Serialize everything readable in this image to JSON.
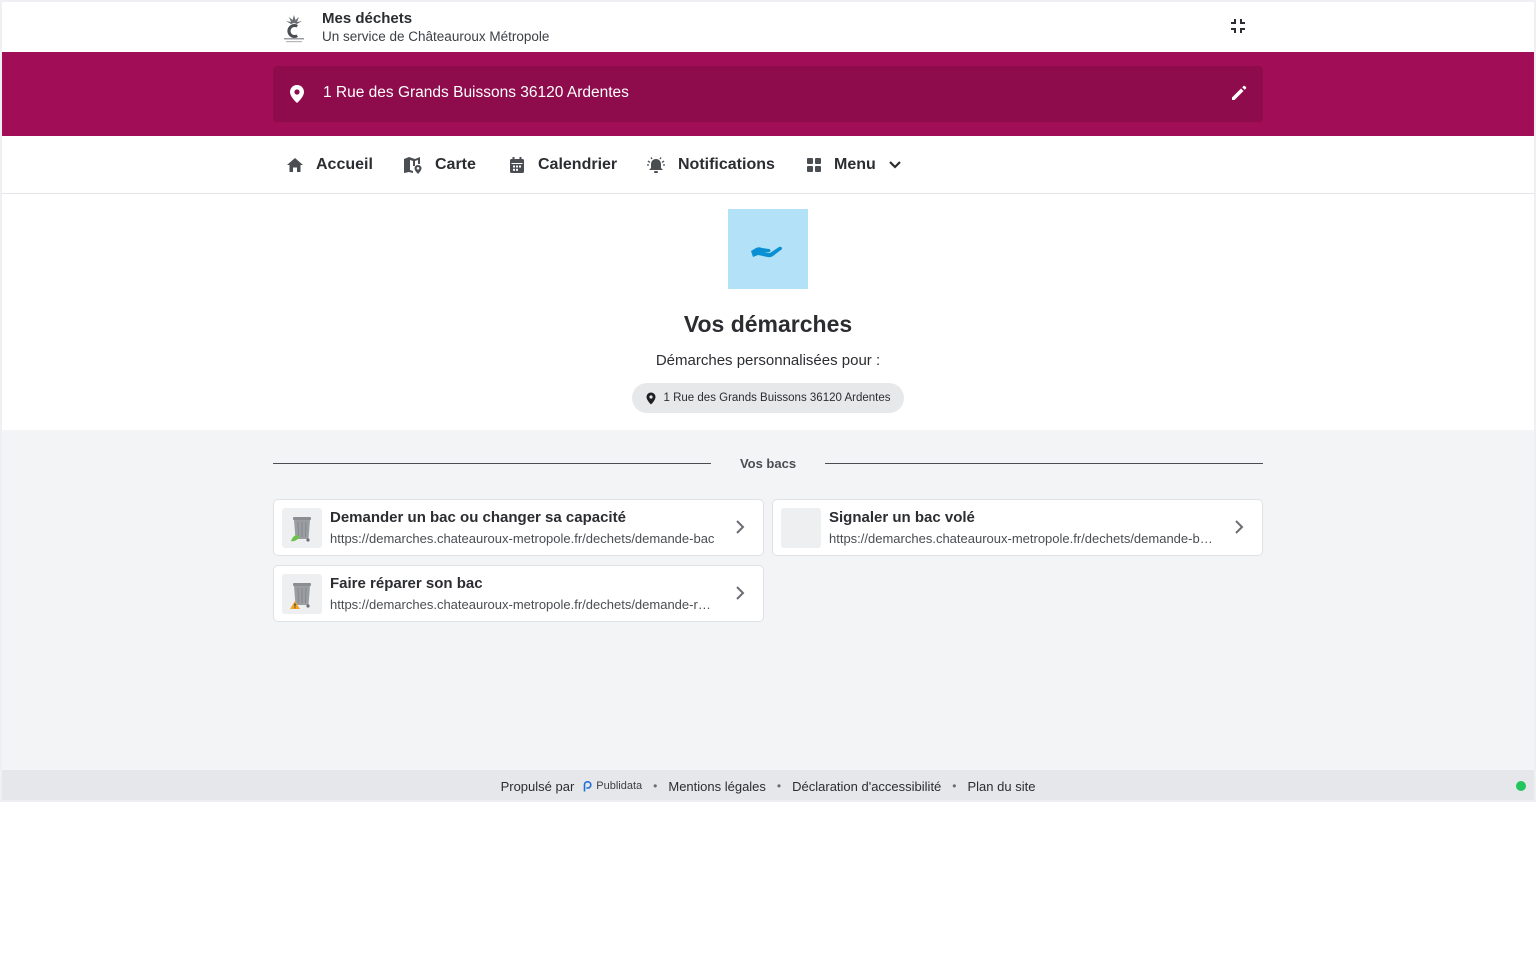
{
  "header": {
    "title": "Mes déchets",
    "subtitle": "Un service de Châteauroux Métropole"
  },
  "address": {
    "text": "1 Rue des Grands Buissons 36120 Ardentes"
  },
  "nav": {
    "items": [
      {
        "label": "Accueil",
        "icon": "home-icon"
      },
      {
        "label": "Carte",
        "icon": "map-icon"
      },
      {
        "label": "Calendrier",
        "icon": "calendar-icon"
      },
      {
        "label": "Notifications",
        "icon": "bell-icon"
      },
      {
        "label": "Menu",
        "icon": "grid-icon"
      }
    ]
  },
  "hero": {
    "title": "Vos démarches",
    "subtitle": "Démarches personnalisées pour :",
    "chip": "1 Rue des Grands Buissons 36120 Ardentes"
  },
  "section": {
    "label": "Vos bacs"
  },
  "cards": [
    {
      "title": "Demander un bac ou changer sa capacité",
      "url": "https://demarches.chateauroux-metropole.fr/dechets/demande-bac"
    },
    {
      "title": "Signaler un bac volé",
      "url": "https://demarches.chateauroux-metropole.fr/dechets/demande-bac-vole"
    },
    {
      "title": "Faire réparer son bac",
      "url": "https://demarches.chateauroux-metropole.fr/dechets/demande-reparation"
    }
  ],
  "footer": {
    "powered": "Propulsé par",
    "brand": "Publidata",
    "links": [
      "Mentions légales",
      "Déclaration d'accessibilité",
      "Plan du site"
    ]
  },
  "colors": {
    "brand": "#a20d57",
    "brand_dark": "#8e0b4c",
    "hero_icon_bg": "#b3e1f7",
    "hero_icon": "#0b8fd3",
    "status": "#22c55e"
  }
}
